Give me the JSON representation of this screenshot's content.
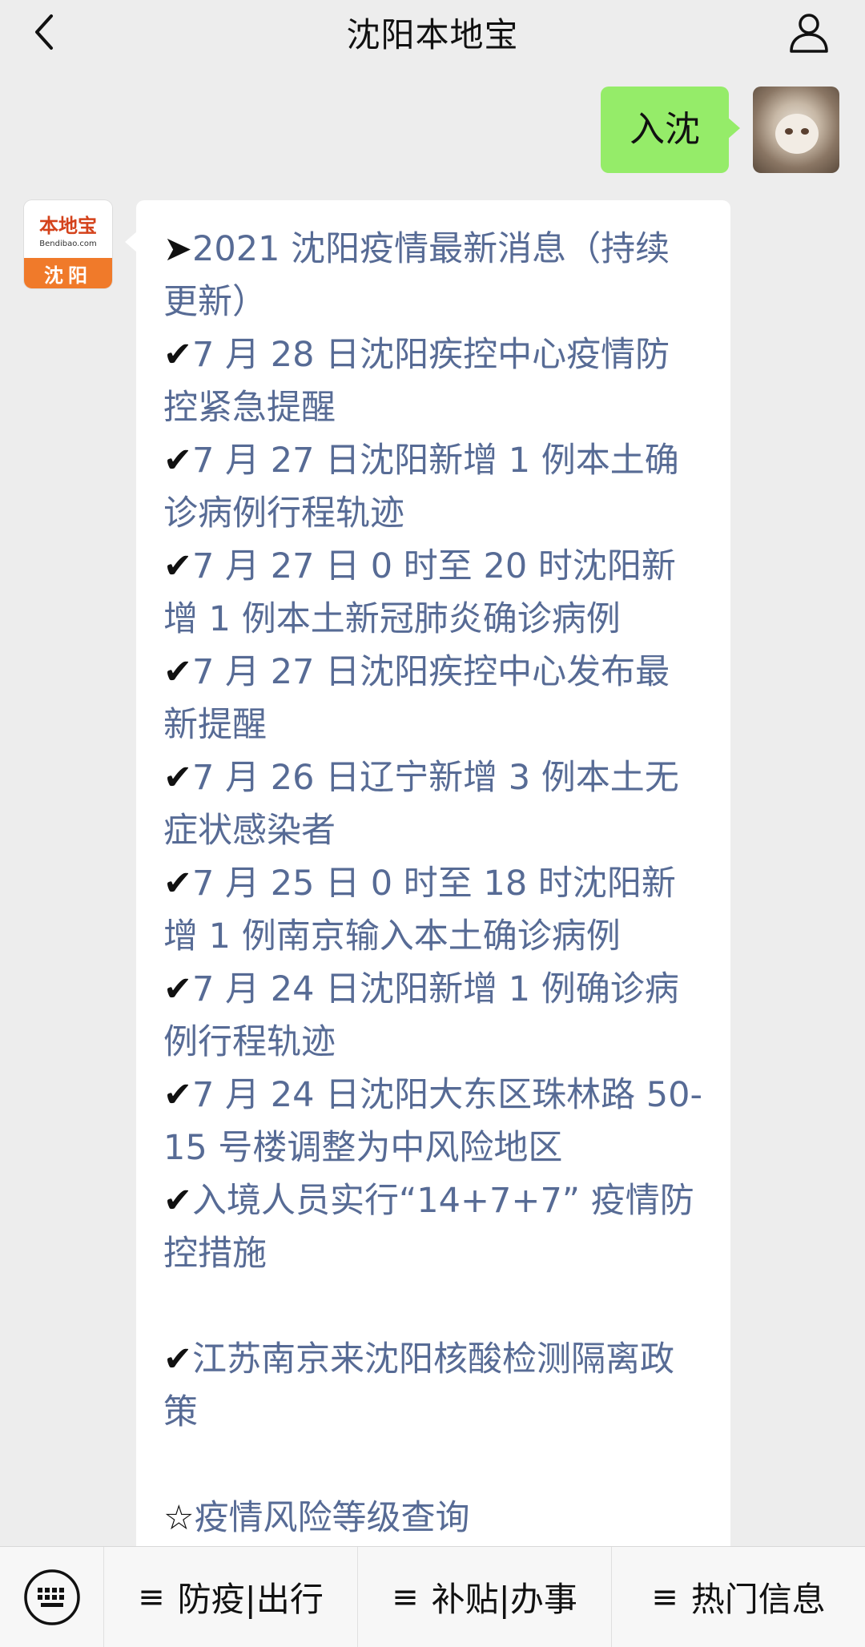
{
  "header": {
    "title": "沈阳本地宝"
  },
  "outgoing": {
    "text": "入沈"
  },
  "brand": {
    "logo_text": "本地宝",
    "domain": "Bendibao.com",
    "city": "沈阳"
  },
  "message": {
    "lines": [
      {
        "mark": "➤",
        "text": "2021 沈阳疫情最新消息（持续更新）"
      },
      {
        "mark": "✔",
        "text": "7 月 28 日沈阳疾控中心疫情防控紧急提醒"
      },
      {
        "mark": "✔",
        "text": "7 月 27 日沈阳新增 1 例本土确诊病例行程轨迹"
      },
      {
        "mark": "✔",
        "text": "7 月 27 日 0 时至 20 时沈阳新增 1 例本土新冠肺炎确诊病例"
      },
      {
        "mark": "✔",
        "text": "7 月 27 日沈阳疾控中心发布最新提醒"
      },
      {
        "mark": "✔",
        "text": "7 月 26 日辽宁新增 3 例本土无症状感染者"
      },
      {
        "mark": "✔",
        "text": "7 月 25 日 0 时至 18 时沈阳新增 1 例南京输入本土确诊病例"
      },
      {
        "mark": "✔",
        "text": "7 月 24 日沈阳新增 1 例确诊病例行程轨迹"
      },
      {
        "mark": "✔",
        "text": "7 月 24 日沈阳大东区珠林路 50-15 号楼调整为中风险地区"
      },
      {
        "mark": "✔",
        "text": "入境人员实行“14+7+7” 疫情防控措施"
      },
      {
        "mark": "✔",
        "text": "江苏南京来沈阳核酸检测隔离政策"
      },
      {
        "mark": "☆",
        "text": "疫情风险等级查询"
      }
    ]
  },
  "menu": {
    "items": [
      {
        "label": "防疫|出行"
      },
      {
        "label": "补贴|办事"
      },
      {
        "label": "热门信息"
      }
    ]
  },
  "icons": {
    "back": "chevron-left-icon",
    "profile": "person-icon",
    "keyboard": "keyboard-icon",
    "menu": "hamburger-icon"
  },
  "colors": {
    "outgoing_bubble": "#95ec69",
    "link_text": "#576b95",
    "brand_orange": "#f07a2a",
    "background": "#ededed"
  }
}
